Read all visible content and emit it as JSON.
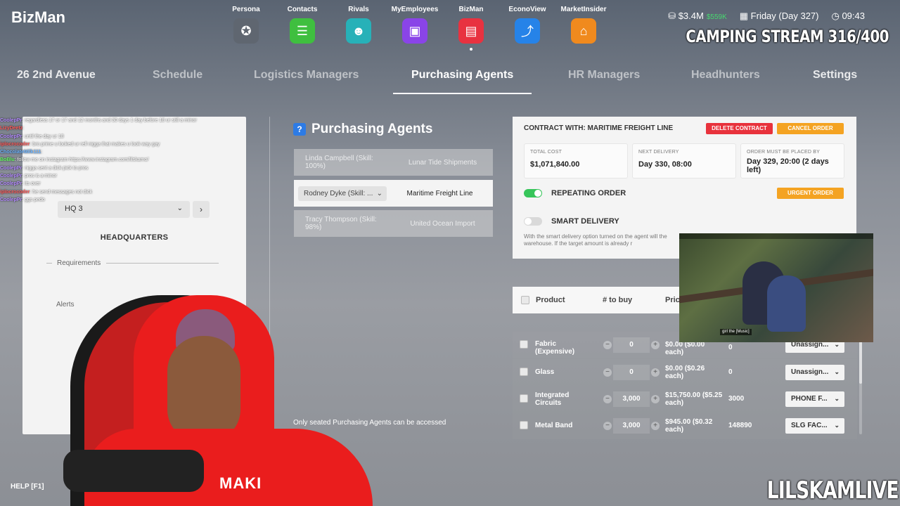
{
  "app": {
    "title": "BizMan"
  },
  "apps": [
    {
      "label": "Persona",
      "icon": "star-icon",
      "glyph": "✪",
      "color": "#5f6670"
    },
    {
      "label": "Contacts",
      "icon": "chat-icon",
      "glyph": "☰",
      "color": "#3fbf3f"
    },
    {
      "label": "Rivals",
      "icon": "group-icon",
      "glyph": "☻",
      "color": "#27b1b8"
    },
    {
      "label": "MyEmployees",
      "icon": "badge-icon",
      "glyph": "▣",
      "color": "#8a44e8"
    },
    {
      "label": "BizMan",
      "icon": "store-icon",
      "glyph": "▤",
      "color": "#e83240"
    },
    {
      "label": "EconoView",
      "icon": "trend-icon",
      "glyph": "⤴",
      "color": "#2683e8"
    },
    {
      "label": "MarketInsider",
      "icon": "house-icon",
      "glyph": "⌂",
      "color": "#f08a1e"
    }
  ],
  "status": {
    "money": "$3.4M",
    "money_gain": "$559K",
    "day": "Friday (Day 327)",
    "time": "09:43"
  },
  "overlay": {
    "stream_title": "CAMPING STREAM 316/400",
    "watermark": "LILSKAMLIVE"
  },
  "nav_tabs": {
    "address": "26 2nd Avenue",
    "schedule": "Schedule",
    "logistics": "Logistics Managers",
    "purchasing": "Purchasing Agents",
    "hr": "HR Managers",
    "headhunters": "Headhunters",
    "settings": "Settings"
  },
  "hq_panel": {
    "selected": "HQ 3",
    "title": "HEADQUARTERS",
    "requirements": "Requirements",
    "alerts": "Alerts"
  },
  "chat": [
    {
      "name": "CoolepPr",
      "text": ": regardless 17 or 17 and 12 months and 30 days 1 day before 18 ur still a minor",
      "cls": ""
    },
    {
      "name": "LizyDeetz",
      "text": ":",
      "cls": "r"
    },
    {
      "name": "CoolepPr",
      "text": ": until the day ur 18",
      "cls": ""
    },
    {
      "name": "iplocrocoder",
      "text": ": bro prime u looked ur rell nigga that makes u look way gay",
      "cls": "r"
    },
    {
      "name": "ChocolateMilk111",
      "text": ":",
      "cls": "b"
    },
    {
      "name": "BoBlu",
      "text": ": follow me on instagram https://www.instagram.com/lilskamo/",
      "cls": "g"
    },
    {
      "name": "CoolepPr",
      "text": ": nigga sent a dick pick to pros",
      "cls": ""
    },
    {
      "name": "CoolepPr",
      "text": ": pros is a minor",
      "cls": ""
    },
    {
      "name": "CoolepPr",
      "text": ": its over",
      "cls": ""
    },
    {
      "name": "iplocrocoder",
      "text": ": he send messages not dick",
      "cls": "r"
    },
    {
      "name": "CoolepPr",
      "text": ": ggs pedo",
      "cls": ""
    }
  ],
  "purchasing": {
    "heading": "Purchasing Agents",
    "agents": [
      {
        "name": "Linda Campbell (Skill: 100%)",
        "company": "Lunar Tide Shipments"
      },
      {
        "name": "Rodney Dyke (Skill: ...",
        "company": "Maritime Freight Line"
      },
      {
        "name": "Tracy Thompson (Skill: 98%)",
        "company": "United Ocean Import"
      }
    ],
    "notice": "Only seated Purchasing Agents can be accessed"
  },
  "contract": {
    "title": "CONTRACT WITH: MARITIME FREIGHT LINE",
    "delete_label": "DELETE CONTRACT",
    "cancel_label": "CANCEL ORDER",
    "total_cost_label": "TOTAL COST",
    "total_cost": "$1,071,840.00",
    "next_delivery_label": "NEXT DELIVERY",
    "next_delivery": "Day 330, 08:00",
    "deadline_label": "ORDER MUST BE PLACED BY",
    "deadline": "Day 329, 20:00 (2 days left)",
    "repeating_label": "REPEATING ORDER",
    "repeating_on": true,
    "urgent_label": "URGENT ORDER",
    "smart_label": "SMART DELIVERY",
    "smart_on": false,
    "smart_desc": "With the smart delivery option turned on the agent will the warehouse. If the target amount is already r"
  },
  "products": {
    "headers": {
      "product": "Product",
      "to_buy": "# to buy",
      "price": "Pric"
    },
    "rows": [
      {
        "name": "Fabric (Expensive)",
        "qty": "0",
        "price": "$0.00 ($0.00 each)",
        "stock": "0",
        "assign": "Unassign..."
      },
      {
        "name": "Glass",
        "qty": "0",
        "price": "$0.00 ($0.26 each)",
        "stock": "0",
        "assign": "Unassign..."
      },
      {
        "name": "Integrated Circuits",
        "qty": "3,000",
        "price": "$15,750.00 ($5.25 each)",
        "stock": "3000",
        "assign": "PHONE F..."
      },
      {
        "name": "Metal Band",
        "qty": "3,000",
        "price": "$945.00 ($0.32 each)",
        "stock": "148890",
        "assign": "SLG FAC..."
      }
    ]
  },
  "video": {
    "caption": "girl the [Music]"
  },
  "help": {
    "label": "HELP [F1]"
  },
  "webcam": {
    "shirt_logo": "MAKI"
  }
}
